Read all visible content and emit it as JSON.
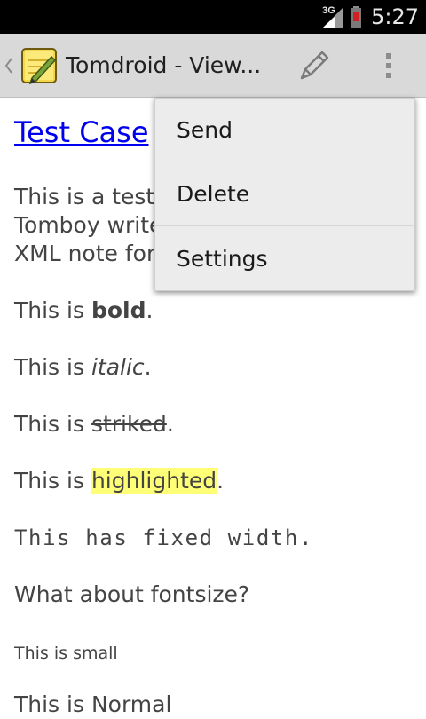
{
  "status_bar": {
    "network": "3G",
    "time": "5:27"
  },
  "action_bar": {
    "title": "Tomdroid - View...",
    "up_icon": "chevron-left-icon",
    "app_icon": "tomdroid-note-icon",
    "edit_icon": "pencil-icon",
    "overflow_icon": "more-vertical-icon"
  },
  "note": {
    "title": "Test Case",
    "intro_line1": "This is a test",
    "intro_line2": "Tomboy write",
    "intro_line3": "XML note forr",
    "bold_prefix": "This is ",
    "bold_word": "bold",
    "bold_suffix": ".",
    "italic_prefix": "This is ",
    "italic_word": "italic",
    "italic_suffix": ".",
    "striked_prefix": "This is ",
    "striked_word": "striked",
    "striked_suffix": ".",
    "highlight_prefix": "This is ",
    "highlight_word": "highlighted",
    "highlight_suffix": ".",
    "fixed_width": "This has fixed width.",
    "fontsize_question": "What about fontsize?",
    "small": "This is small",
    "normal": "This is Normal"
  },
  "overflow_menu": {
    "items": [
      {
        "label": "Send"
      },
      {
        "label": "Delete"
      },
      {
        "label": "Settings"
      }
    ]
  },
  "colors": {
    "link": "#0000ee",
    "highlight": "#ffff77",
    "action_bar": "#d9d9d9",
    "status_bar": "#000000"
  }
}
